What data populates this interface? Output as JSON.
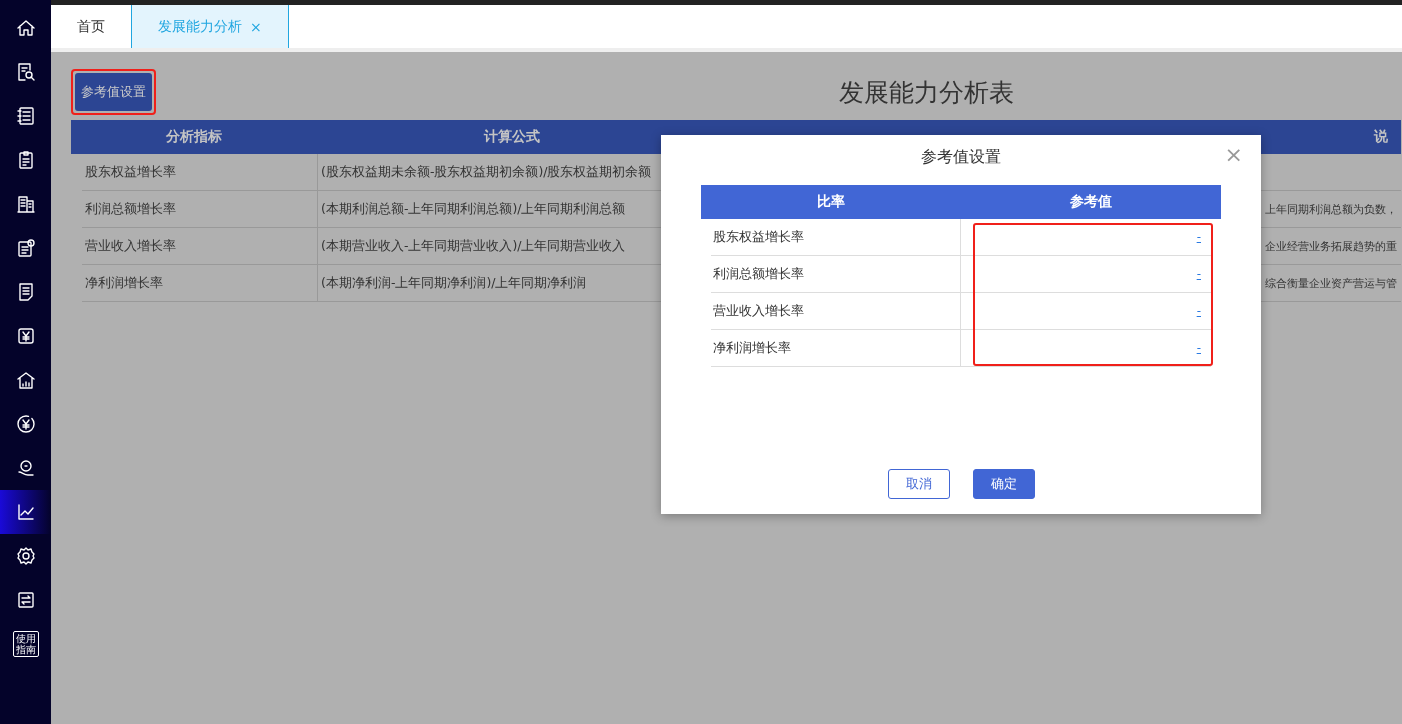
{
  "sidebar": {
    "items": [
      {
        "selected": false
      },
      {
        "selected": false
      },
      {
        "selected": false
      },
      {
        "selected": false
      },
      {
        "selected": false
      },
      {
        "selected": false
      },
      {
        "selected": false
      },
      {
        "selected": false
      },
      {
        "selected": false
      },
      {
        "selected": false
      },
      {
        "selected": false
      },
      {
        "selected": true
      },
      {
        "selected": false
      },
      {
        "selected": false
      },
      {
        "selected": false,
        "label": "使用指南"
      }
    ]
  },
  "tabs": [
    {
      "label": "首页",
      "selected": false
    },
    {
      "label": "发展能力分析",
      "selected": true,
      "close": "×"
    }
  ],
  "toolbar": {
    "button": "参考值设置",
    "highlighted": true
  },
  "page_title": "发展能力分析表",
  "table": {
    "columns": [
      "分析指标",
      "计算公式",
      "",
      "说"
    ],
    "rows": [
      [
        "股东权益增长率",
        "(股东权益期未余额-股东权益期初余额)/股东权益期初余额",
        ""
      ],
      [
        "利润总额增长率",
        "(本期利润总额-上年同期利润总额)/上年同期利润总额",
        "上年同期利润总额为负数，"
      ],
      [
        "营业收入增长率",
        "(本期营业收入-上年同期营业收入)/上年同期营业收入",
        "企业经营业务拓展趋势的重"
      ],
      [
        "净利润增长率",
        "(本期净利润-上年同期净利润)/上年同期净利润",
        "综合衡量企业资产营运与管"
      ]
    ]
  },
  "dialog": {
    "title": "参考值设置",
    "close": "×",
    "columns": [
      "比率",
      "参考值"
    ],
    "highlighted": true,
    "rows": [
      {
        "name": "股东权益增长率",
        "value": "-"
      },
      {
        "name": "利润总额增长率",
        "value": "-"
      },
      {
        "name": "营业收入增长率",
        "value": "-"
      },
      {
        "name": "净利润增长率",
        "value": "-"
      }
    ],
    "buttons": [
      {
        "label": "取消",
        "kind": "secondary"
      },
      {
        "label": "确定",
        "kind": "primary"
      }
    ]
  }
}
